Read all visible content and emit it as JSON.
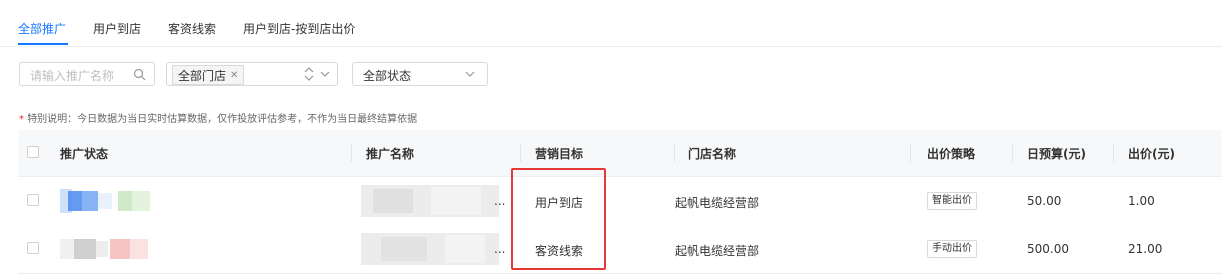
{
  "tabs": [
    {
      "label": "全部推广",
      "active": true
    },
    {
      "label": "用户到店"
    },
    {
      "label": "客资线索"
    },
    {
      "label": "用户到店-按到店出价"
    }
  ],
  "filters": {
    "search_placeholder": "请输入推广名称",
    "store_tag": "全部门店",
    "status_value": "全部状态"
  },
  "note": {
    "star": "*",
    "text": "特别说明：今日数据为当日实时估算数据，仅作投放评估参考，不作为当日最终结算依据"
  },
  "table": {
    "headers": [
      "推广状态",
      "推广名称",
      "营销目标",
      "门店名称",
      "出价策略",
      "日预算(元)",
      "出价(元)"
    ],
    "rows": [
      {
        "target": "用户到店",
        "store": "起帆电缆经营部",
        "strategy": "智能出价",
        "budget": "50.00",
        "bid": "1.00",
        "name_ellipsis": "..."
      },
      {
        "target": "客资线索",
        "store": "起帆电缆经营部",
        "strategy": "手动出价",
        "budget": "500.00",
        "bid": "21.00",
        "name_ellipsis": "..."
      }
    ]
  },
  "colors": {
    "accent": "#1677ff",
    "highlight": "#e53935"
  }
}
